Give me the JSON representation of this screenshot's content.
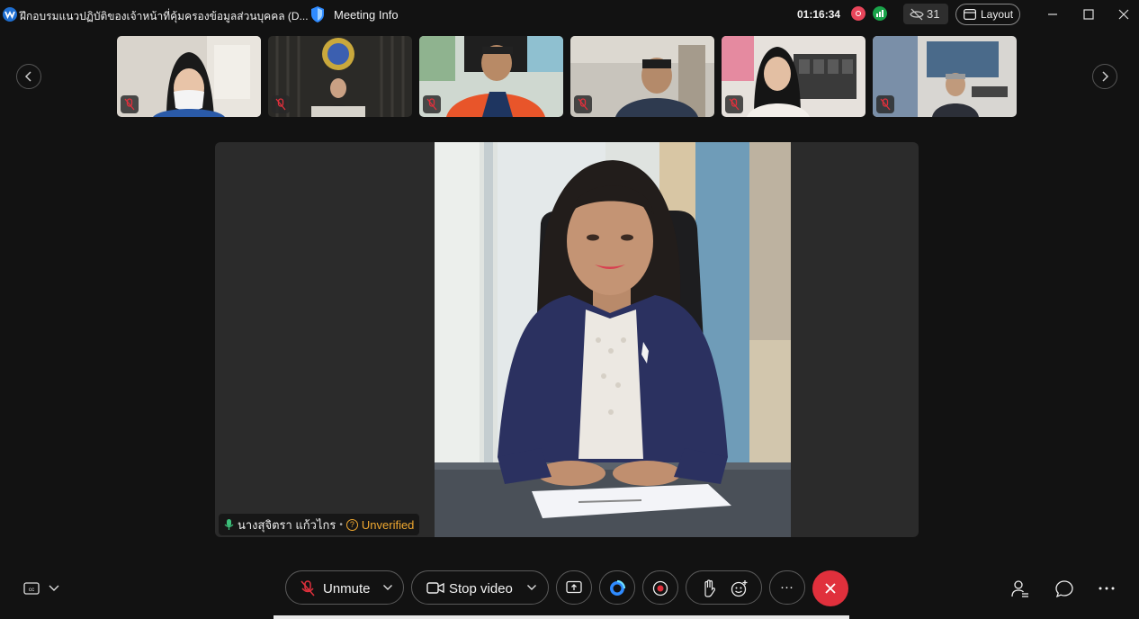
{
  "window": {
    "title": "ฝึกอบรมแนวปฏิบัติของเจ้าหน้าที่คุ้มครองข้อมูลส่วนบุคคล (D...",
    "meeting_info": "Meeting Info",
    "timer": "01:16:34",
    "participant_count": "31",
    "layout_label": "Layout"
  },
  "filmstrip": {
    "tiles": [
      {
        "name": "participant-1",
        "muted": true
      },
      {
        "name": "participant-2",
        "muted": true
      },
      {
        "name": "participant-3",
        "muted": true
      },
      {
        "name": "participant-4",
        "muted": true
      },
      {
        "name": "participant-5",
        "muted": true
      },
      {
        "name": "participant-6",
        "muted": true
      }
    ]
  },
  "speaker": {
    "name": "นางสุจิตรา แก้วไกร",
    "separator": "•",
    "status": "Unverified"
  },
  "controls": {
    "unmute_label": "Unmute",
    "stop_video_label": "Stop video",
    "more_label": "···"
  },
  "colors": {
    "background": "#121212",
    "stage": "#2b2b2b",
    "end_call": "#e0303c",
    "recording": "#e8455a",
    "network": "#1aa34a",
    "unverified": "#f0a830",
    "muted_mic": "#e0303c"
  }
}
